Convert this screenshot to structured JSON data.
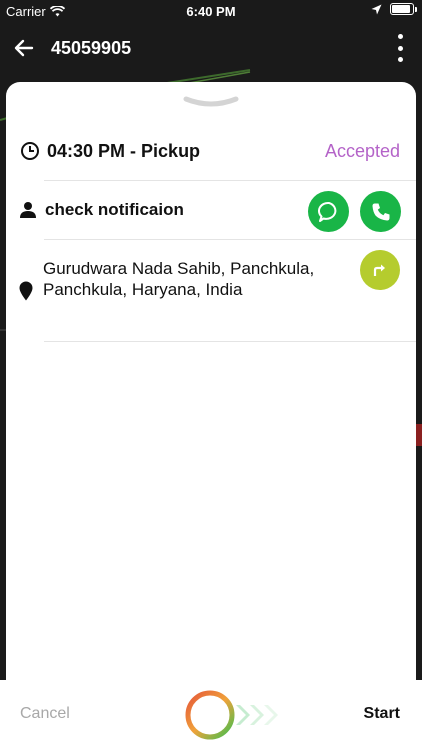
{
  "status_bar": {
    "carrier": "Carrier",
    "time": "6:40 PM"
  },
  "header": {
    "order_id": "45059905"
  },
  "trip": {
    "pickup_label": "04:30 PM - Pickup",
    "status": "Accepted",
    "customer_name": "check notificaion",
    "address": "Gurudwara Nada Sahib, Panchkula, Panchkula, Haryana, India"
  },
  "footer": {
    "cancel_label": "Cancel",
    "start_label": "Start"
  },
  "colors": {
    "status_accent": "#b463c8",
    "action_green": "#19b547",
    "navigate_lime": "#b5cc2e"
  },
  "icons": {
    "back": "arrow-left-icon",
    "more": "more-vertical-icon",
    "clock": "clock-icon",
    "person": "person-icon",
    "chat": "chat-bubble-icon",
    "phone": "phone-icon",
    "location": "location-pin-icon",
    "navigate": "turn-right-arrow-icon",
    "slider": "slide-to-start-icon"
  }
}
